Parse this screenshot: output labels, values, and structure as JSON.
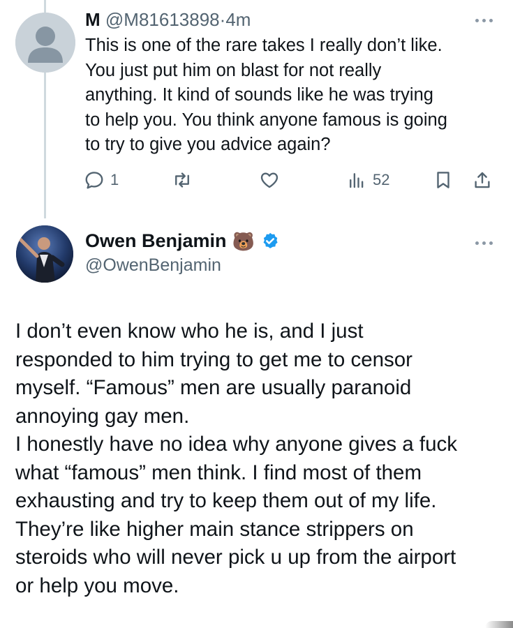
{
  "reply": {
    "name": "M",
    "handle": "@M81613898",
    "separator": "·",
    "time": "4m",
    "text": "This is one of the rare takes I really don’t like.\nYou just put him on blast for not really\nanything. It kind of sounds like he was trying\nto help you. You think anyone famous is going\nto try to give you advice again?",
    "actions": {
      "reply_count": "1",
      "views_count": "52"
    },
    "icons": [
      "comment-icon",
      "retweet-icon",
      "heart-icon",
      "views-icon",
      "bookmark-icon",
      "share-icon"
    ]
  },
  "tweet": {
    "name": "Owen Benjamin",
    "emoji": "🐻",
    "handle": "@OwenBenjamin",
    "verified_color": "#1d9bf0",
    "text": "I don’t even know who he is, and I just\nresponded to him trying to get me to censor\nmyself. “Famous” men are usually paranoid\nannoying gay men.\nI honestly have no idea why anyone gives a fuck\nwhat “famous” men think. I find most of them\nexhausting and try to keep them out of my life.\nThey’re like higher main stance strippers on\nsteroids who will never pick u up from the airport\nor help you move."
  }
}
